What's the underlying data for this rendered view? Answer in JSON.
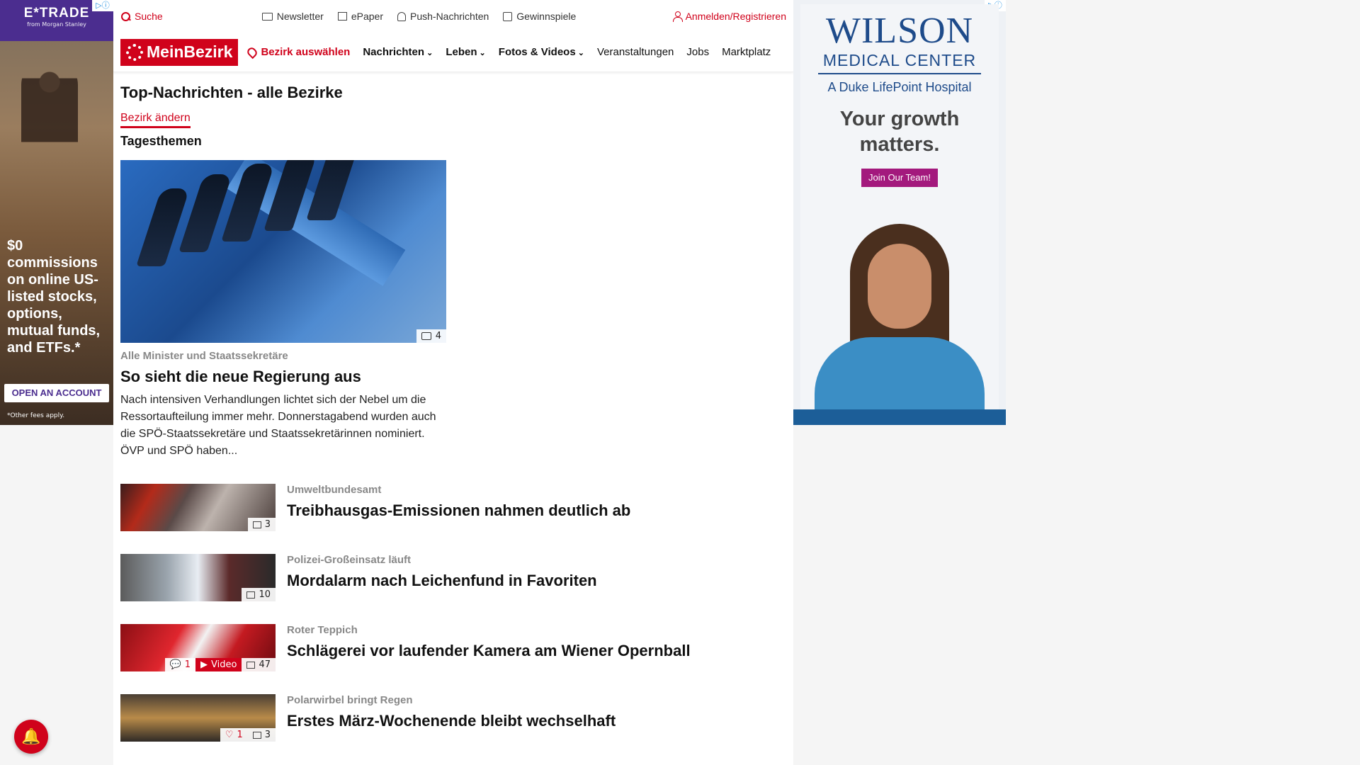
{
  "ads": {
    "left": {
      "brand": "E*TRADE",
      "sub": "from Morgan Stanley",
      "copy": "$0 commissions on online US-listed stocks, options, mutual funds, and ETFs.*",
      "cta": "OPEN AN ACCOUNT",
      "footnote": "*Other fees apply."
    },
    "right": {
      "brand": "WILSON",
      "brand_sub": "MEDICAL CENTER",
      "affiliation": "A Duke LifePoint Hospital",
      "headline": "Your growth matters.",
      "cta": "Join Our Team!"
    }
  },
  "utility_bar": {
    "search": "Suche",
    "links": [
      {
        "icon": "mail-icon",
        "label": "Newsletter"
      },
      {
        "icon": "epaper-icon",
        "label": "ePaper"
      },
      {
        "icon": "bell-icon",
        "label": "Push-Nachrichten"
      },
      {
        "icon": "gift-icon",
        "label": "Gewinnspiele"
      }
    ],
    "login": "Anmelden/Registrieren"
  },
  "nav": {
    "logo": "MeinBezirk",
    "region": "Bezirk auswählen",
    "items": [
      "Nachrichten",
      "Leben",
      "Fotos & Videos",
      "Veranstaltungen",
      "Jobs",
      "Marktplatz"
    ]
  },
  "page": {
    "title": "Top-Nachrichten - alle Bezirke",
    "change_link": "Bezirk ändern",
    "section": "Tagesthemen"
  },
  "hero": {
    "image_count": "4",
    "kicker": "Alle Minister und Staatssekretäre",
    "title": "So sieht die neue Regierung aus",
    "teaser": "Nach intensiven Verhandlungen lichtet sich der Nebel um die Ressortaufteilung immer mehr. Donnerstagabend wurden auch die SPÖ-Staatssekretäre und Staatssekretärinnen nominiert. ÖVP und SPÖ haben..."
  },
  "articles": [
    {
      "kicker": "Umweltbundesamt",
      "title": "Treibhausgas-Emissionen nahmen deutlich ab",
      "images": "3"
    },
    {
      "kicker": "Polizei-Großeinsatz läuft",
      "title": "Mordalarm nach Leichenfund in Favoriten",
      "images": "10"
    },
    {
      "kicker": "Roter Teppich",
      "title": "Schlägerei vor laufender Kamera am Wiener Opernball",
      "comments": "1",
      "video": "Video",
      "images": "47"
    },
    {
      "kicker": "Polarwirbel bringt Regen",
      "title": "Erstes März-Wochenende bleibt wechselhaft",
      "likes": "1",
      "images": "3"
    }
  ],
  "colors": {
    "accent": "#d0021b"
  }
}
